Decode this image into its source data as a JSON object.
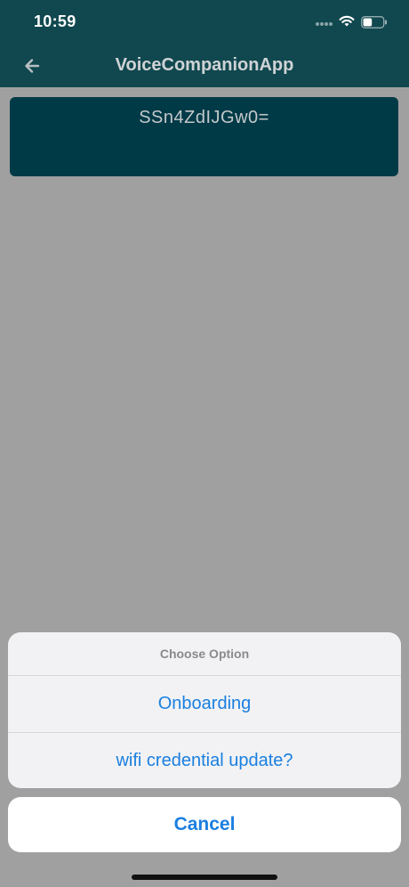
{
  "status_bar": {
    "time": "10:59",
    "signal_icon": "signal-dots-icon",
    "wifi_icon": "wifi-icon",
    "battery_icon": "battery-icon",
    "battery_level": 0.45
  },
  "nav": {
    "back_icon": "arrow-left-icon",
    "title": "VoiceCompanionApp"
  },
  "card": {
    "code": "SSn4ZdIJGw0="
  },
  "action_sheet": {
    "title": "Choose Option",
    "options": [
      {
        "label": "Onboarding"
      },
      {
        "label": "wifi credential update?"
      }
    ],
    "cancel_label": "Cancel"
  },
  "colors": {
    "header_bg": "#11484f",
    "card_bg": "#003a47",
    "accent": "#1a7fe0",
    "overlay_bg": "#a0a0a0"
  }
}
